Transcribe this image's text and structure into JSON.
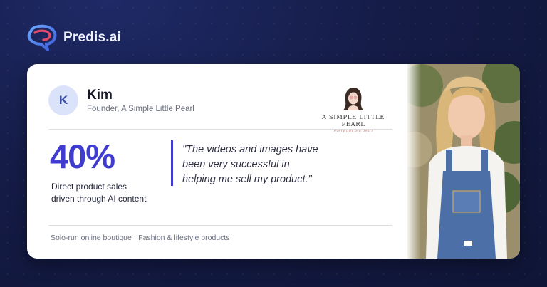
{
  "brand": {
    "name": "Predis.ai",
    "logo_icon": "chat-bubble-logo-icon"
  },
  "testimonial": {
    "avatar_initial": "K",
    "name": "Kim",
    "role": "Founder, A Simple Little Pearl",
    "company_logo": {
      "title": "A SIMPLE LITTLE PEARL",
      "tagline": "every girl is a pearl"
    },
    "stat_value": "40%",
    "stat_caption": "Direct product sales driven through AI content",
    "quote": "\"The videos and images have been very successful in helping me sell my product.\"",
    "footer": "Solo-run online boutique · Fashion & lifestyle products"
  },
  "colors": {
    "accent": "#3f3ccf",
    "background": "#151c47",
    "card": "#ffffff"
  }
}
